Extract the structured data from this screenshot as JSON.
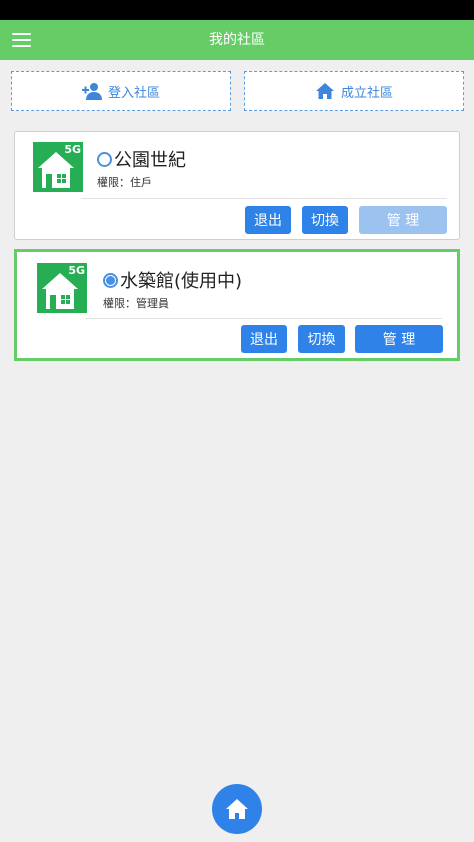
{
  "appbar": {
    "title": "我的社區",
    "menu_icon": "hamburger-menu-icon"
  },
  "actions": {
    "join": {
      "label": "登入社區",
      "icon": "add-user-icon"
    },
    "create": {
      "label": "成立社區",
      "icon": "home-icon"
    }
  },
  "communities": [
    {
      "badge": "5G",
      "name": "公園世紀",
      "selected": false,
      "role": "權限：住戶",
      "buttons": {
        "leave": "退出",
        "switch": "切換",
        "manage": "管 理"
      },
      "manage_enabled": false
    },
    {
      "badge": "5G",
      "name": "水築館(使用中)",
      "selected": true,
      "role": "權限：管理員",
      "buttons": {
        "leave": "退出",
        "switch": "切換",
        "manage": "管 理"
      },
      "manage_enabled": true
    }
  ],
  "colors": {
    "appbar": "#66cc66",
    "primary_button": "#2e82e8",
    "disabled_button": "#9cc3f0",
    "active_border": "#66cc66",
    "logo": "#27ae54"
  }
}
